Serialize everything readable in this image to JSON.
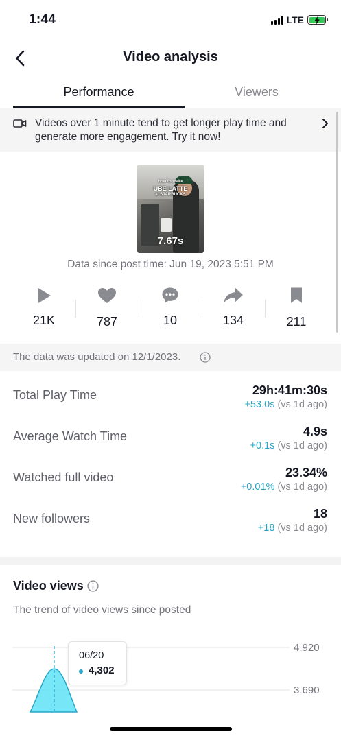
{
  "status_bar": {
    "time": "1:44",
    "network": "LTE"
  },
  "nav": {
    "title": "Video analysis"
  },
  "tabs": [
    {
      "label": "Performance",
      "active": true
    },
    {
      "label": "Viewers",
      "active": false
    }
  ],
  "tip": {
    "text": "Videos over 1 minute tend to get longer play time and generate more engagement. Try it now!"
  },
  "video": {
    "caption_line1": "how to make",
    "caption_line2": "UBE LATTE",
    "caption_line3": "at STARBUCKS",
    "duration": "7.67s",
    "post_time": "Data since post time: Jun 19, 2023 5:51 PM"
  },
  "stats": [
    {
      "icon": "play-icon",
      "value": "21K"
    },
    {
      "icon": "heart-icon",
      "value": "787"
    },
    {
      "icon": "comment-icon",
      "value": "10"
    },
    {
      "icon": "share-icon",
      "value": "134"
    },
    {
      "icon": "bookmark-icon",
      "value": "211"
    }
  ],
  "updated": {
    "text": "The data was updated on 12/1/2023."
  },
  "metrics": [
    {
      "label": "Total Play Time",
      "value": "29h:41m:30s",
      "delta": "+53.0s",
      "compare": " (vs 1d ago)"
    },
    {
      "label": "Average Watch Time",
      "value": "4.9s",
      "delta": "+0.1s",
      "compare": " (vs 1d ago)"
    },
    {
      "label": "Watched full video",
      "value": "23.34%",
      "delta": "+0.01%",
      "compare": " (vs 1d ago)"
    },
    {
      "label": "New followers",
      "value": "18",
      "delta": "+18",
      "compare": " (vs 1d ago)"
    }
  ],
  "video_views": {
    "title": "Video views",
    "subtitle": "The trend of video views since posted",
    "tooltip": {
      "date": "06/20",
      "value": "4,302"
    }
  },
  "colors": {
    "accent": "#2aa6c6",
    "area_fill": "#5fe3f6",
    "text_primary": "#161823",
    "text_secondary": "#73747b"
  },
  "chart_data": {
    "type": "area",
    "y_ticks": [
      "4,920",
      "3,690"
    ],
    "visible_y_range": [
      3690,
      4920
    ],
    "x": [
      "06/20"
    ],
    "series": [
      {
        "values": [
          4302
        ]
      }
    ],
    "highlight": {
      "x": "06/20",
      "value": 4302
    }
  }
}
